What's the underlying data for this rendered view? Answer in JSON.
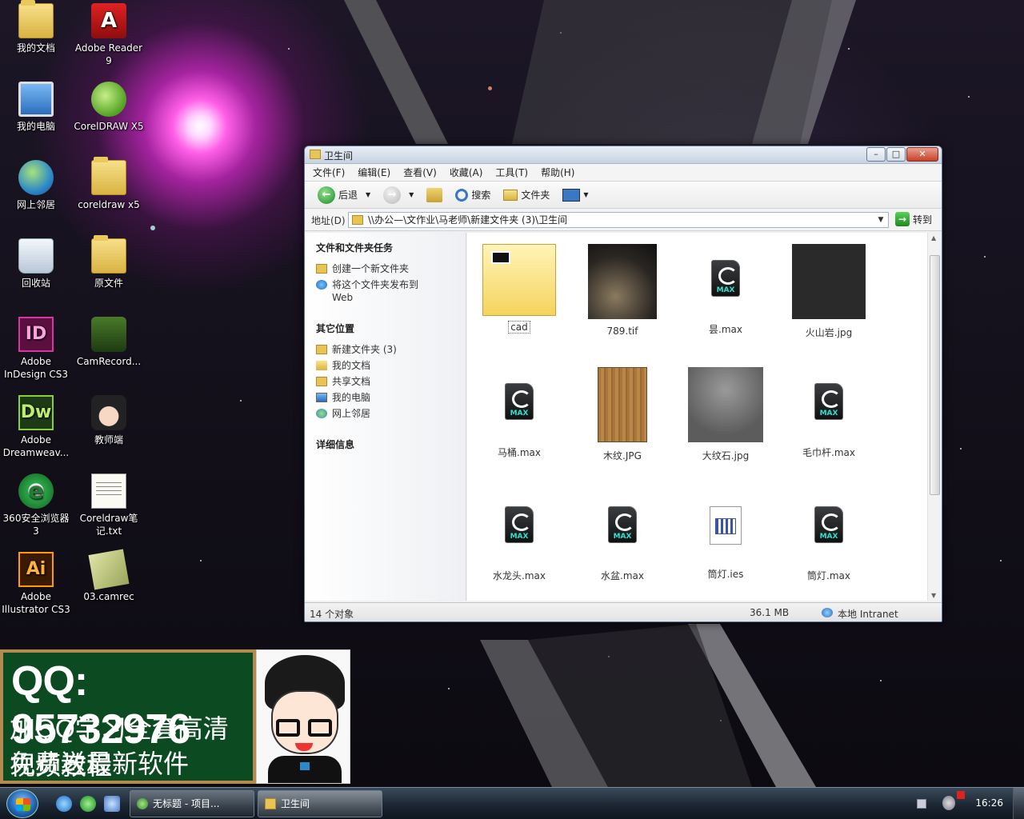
{
  "desktop": {
    "icons": [
      {
        "label": "我的文档",
        "icon": "my-documents-icon"
      },
      {
        "label": "Adobe Reader 9",
        "icon": "adobe-reader-icon"
      },
      {
        "label": "我的电脑",
        "icon": "my-computer-icon"
      },
      {
        "label": "CorelDRAW X5",
        "icon": "coreldraw-icon"
      },
      {
        "label": "网上邻居",
        "icon": "network-icon"
      },
      {
        "label": "coreldraw x5",
        "icon": "folder-icon"
      },
      {
        "label": "回收站",
        "icon": "recycle-bin-icon"
      },
      {
        "label": "原文件",
        "icon": "folder-icon"
      },
      {
        "label": "Adobe InDesign CS3",
        "icon": "indesign-icon"
      },
      {
        "label": "CamRecord...",
        "icon": "camrecorder-icon"
      },
      {
        "label": "Adobe Dreamweav...",
        "icon": "dreamweaver-icon"
      },
      {
        "label": "教师端",
        "icon": "teacher-client-icon"
      },
      {
        "label": "360安全浏览器3",
        "icon": "browser-360-icon"
      },
      {
        "label": "Coreldraw笔记.txt",
        "icon": "text-file-icon"
      },
      {
        "label": "Adobe Illustrator CS3",
        "icon": "illustrator-icon"
      },
      {
        "label": "03.camrec",
        "icon": "camrec-file-icon"
      }
    ]
  },
  "window": {
    "title": "卫生间",
    "menu": [
      "文件(F)",
      "编辑(E)",
      "查看(V)",
      "收藏(A)",
      "工具(T)",
      "帮助(H)"
    ],
    "toolbar": {
      "back": "后退",
      "search": "搜索",
      "folders": "文件夹"
    },
    "address": {
      "label": "地址(D)",
      "value": "\\\\办公—\\文作业\\马老师\\新建文件夹 (3)\\卫生间",
      "go": "转到"
    },
    "left_pane": {
      "tasks": {
        "title": "文件和文件夹任务",
        "items": [
          "创建一个新文件夹",
          "将这个文件夹发布到 Web"
        ]
      },
      "places": {
        "title": "其它位置",
        "items": [
          "新建文件夹 (3)",
          "我的文档",
          "共享文档",
          "我的电脑",
          "网上邻居"
        ]
      },
      "details": {
        "title": "详细信息"
      }
    },
    "files": [
      {
        "name": "cad",
        "type": "folder"
      },
      {
        "name": "789.tif",
        "type": "image-dark"
      },
      {
        "name": "昙.max",
        "type": "max"
      },
      {
        "name": "火山岩.jpg",
        "type": "image-black"
      },
      {
        "name": "马桶.max",
        "type": "max"
      },
      {
        "name": "木纹.JPG",
        "type": "image-wood"
      },
      {
        "name": "大纹石.jpg",
        "type": "image-stone"
      },
      {
        "name": "毛巾杆.max",
        "type": "max"
      },
      {
        "name": "水龙头.max",
        "type": "max"
      },
      {
        "name": "水盆.max",
        "type": "max"
      },
      {
        "name": "筒灯.ies",
        "type": "ies"
      },
      {
        "name": "筒灯.max",
        "type": "max"
      }
    ],
    "status": {
      "count": "14 个对象",
      "size": "36.1 MB",
      "zone": "本地 Intranet"
    }
  },
  "banner": {
    "qq": "QQ: 95732976",
    "line2": "加QQ学习全套高清视频教程",
    "line3": "免费送最新软件"
  },
  "taskbar": {
    "tasks": [
      {
        "label": "无标题 - 项目..."
      },
      {
        "label": "卫生间"
      }
    ],
    "clock": "16:26"
  }
}
